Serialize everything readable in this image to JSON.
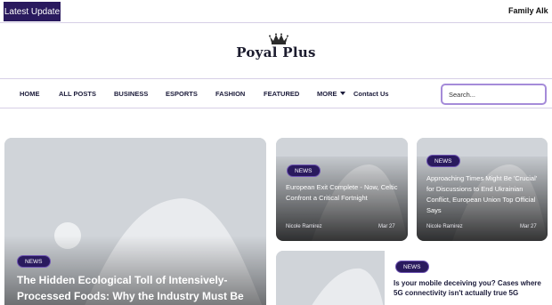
{
  "ticker": {
    "badge": "Latest Update",
    "headline": "Family Alk"
  },
  "logo": {
    "text": "Poyal Plus"
  },
  "nav": {
    "items": [
      "HOME",
      "ALL POSTS",
      "BUSINESS",
      "ESPORTS",
      "FASHION",
      "FEATURED",
      "MORE"
    ],
    "contact": "Contact Us",
    "search_placeholder": "Search..."
  },
  "featured": {
    "badge": "NEWS",
    "title": "The Hidden Ecological Toll of Intensively-Processed Foods: Why the Industry Must Be Accountable"
  },
  "grid": [
    {
      "badge": "NEWS",
      "title": "European Exit Complete - Now, Celtic Confront a Critical Fortnight",
      "author": "Nicole Ramirez",
      "date": "Mar 27"
    },
    {
      "badge": "NEWS",
      "title": "Approaching Times Might Be 'Crucial' for Discussions to End Ukrainian Conflict, European Union Top Official Says",
      "author": "Nicole Ramirez",
      "date": "Mar 27"
    }
  ],
  "list": [
    {
      "badge": "NEWS",
      "title": "Is your mobile deceiving you? Cases where 5G connectivity isn't actually true 5G"
    }
  ],
  "colors": {
    "accent_dark": "#2a1a5e",
    "accent_light": "#a58bd9",
    "placeholder_bg": "#d0d4d9"
  }
}
